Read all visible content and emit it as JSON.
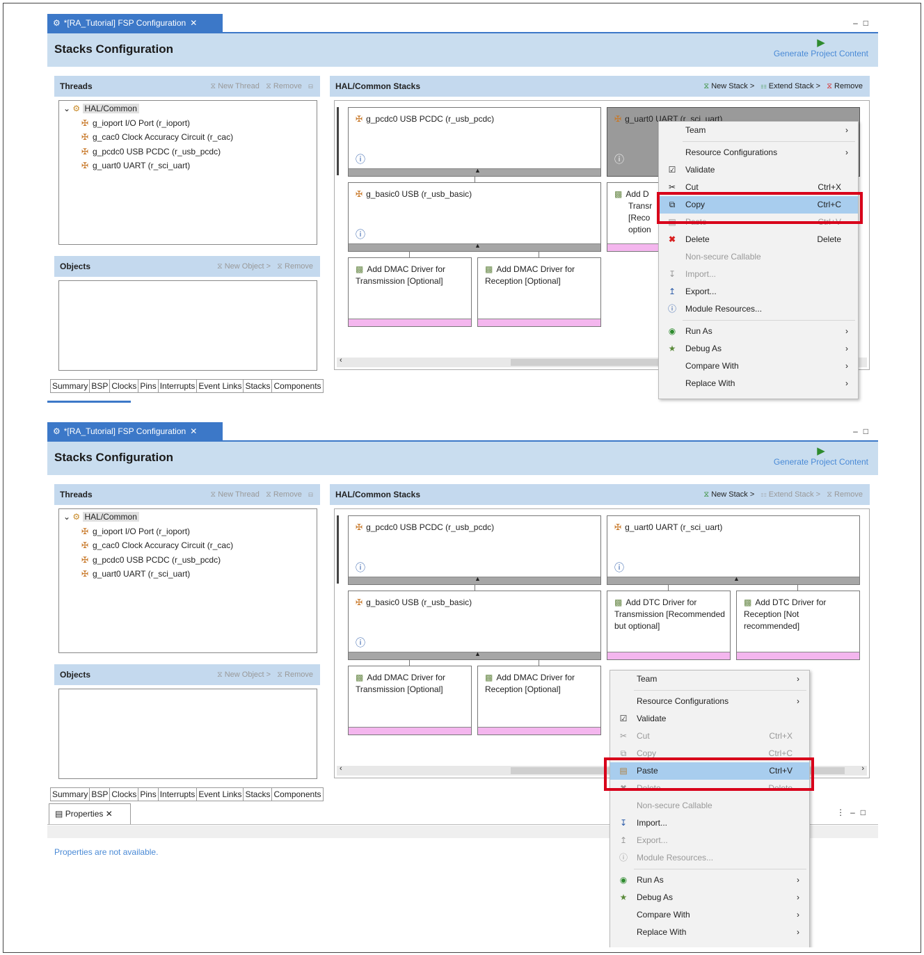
{
  "editor": {
    "tab_label": "*[RA_Tutorial] FSP Configuration",
    "title": "Stacks Configuration",
    "generate_label": "Generate Project Content"
  },
  "threads": {
    "header": "Threads",
    "new_thread": "New Thread",
    "remove": "Remove",
    "root": "HAL/Common",
    "items": [
      "g_ioport I/O Port (r_ioport)",
      "g_cac0 Clock Accuracy Circuit (r_cac)",
      "g_pcdc0 USB PCDC (r_usb_pcdc)",
      "g_uart0 UART (r_sci_uart)"
    ]
  },
  "objects": {
    "header": "Objects",
    "new_object": "New Object >",
    "remove": "Remove"
  },
  "stacks": {
    "header": "HAL/Common Stacks",
    "new_stack": "New Stack >",
    "extend_stack": "Extend Stack >",
    "remove": "Remove",
    "modules": {
      "pcdc": "g_pcdc0 USB PCDC (r_usb_pcdc)",
      "uart": "g_uart0 UART (r_sci_uart)",
      "basic": "g_basic0 USB (r_usb_basic)",
      "dmac_tx": "Add DMAC Driver for Transmission [Optional]",
      "dmac_rx": "Add DMAC Driver for Reception [Optional]",
      "dtc_tx": "Add DTC Driver for Transmission [Recommended but optional]",
      "dtc_rx": "Add DTC Driver for Reception [Not recommended]",
      "dtc_tx_partial_1": "Add D",
      "dtc_tx_partial_2": "Transr",
      "dtc_tx_partial_3": "[Reco",
      "dtc_tx_partial_4": "option"
    }
  },
  "bottom_tabs": [
    "Summary",
    "BSP",
    "Clocks",
    "Pins",
    "Interrupts",
    "Event Links",
    "Stacks",
    "Components"
  ],
  "menu1": {
    "items": [
      {
        "label": "Team",
        "arrow": ">"
      },
      {
        "label": "Resource Configurations",
        "arrow": ">"
      },
      {
        "label": "Validate"
      },
      {
        "label": "Cut",
        "shortcut": "Ctrl+X"
      },
      {
        "label": "Copy",
        "shortcut": "Ctrl+C"
      },
      {
        "label": "Paste",
        "shortcut": "Ctrl+V"
      },
      {
        "label": "Delete",
        "shortcut": "Delete"
      },
      {
        "label": "Non-secure Callable"
      },
      {
        "label": "Import..."
      },
      {
        "label": "Export..."
      },
      {
        "label": "Module Resources..."
      },
      {
        "label": "Run As",
        "arrow": ">"
      },
      {
        "label": "Debug As",
        "arrow": ">"
      },
      {
        "label": "Compare With",
        "arrow": ">"
      },
      {
        "label": "Replace With",
        "arrow": ">"
      }
    ]
  },
  "properties": {
    "tab_label": "Properties",
    "message": "Properties are not available."
  },
  "colors": {
    "accent": "#3c78c8",
    "header_bg": "#c9ddef",
    "highlight_border": "#d8001a",
    "selection": "#a8cdee",
    "optional_bar": "#f4b6ee"
  }
}
